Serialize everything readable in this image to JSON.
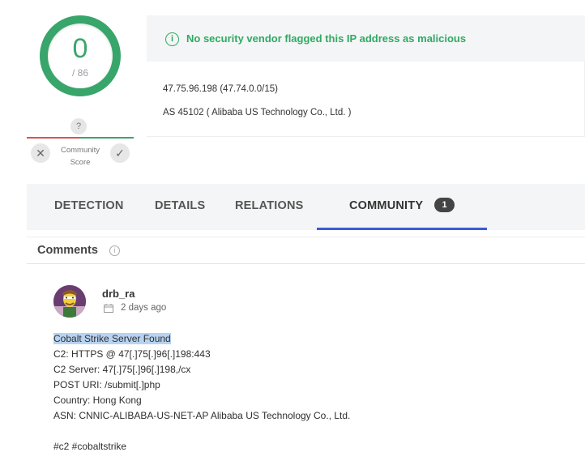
{
  "score": {
    "detections": "0",
    "total": "/ 86"
  },
  "community_score": {
    "label_line1": "Community",
    "label_line2": "Score",
    "question": "?",
    "downvote": "✕",
    "upvote": "✓"
  },
  "status": {
    "message": "No security vendor flagged this IP address as malicious",
    "color": "#2faa63"
  },
  "ip_info": {
    "ip_range": "47.75.96.198  (47.74.0.0/15)",
    "as": "AS 45102 ( Alibaba US Technology Co., Ltd. )"
  },
  "tabs": [
    {
      "label": "DETECTION"
    },
    {
      "label": "DETAILS"
    },
    {
      "label": "RELATIONS"
    },
    {
      "label": "COMMUNITY",
      "badge": "1",
      "active": true
    }
  ],
  "comments": {
    "title": "Comments",
    "items": [
      {
        "user": "drb_ra",
        "date": "2 days ago",
        "lines": [
          "Cobalt Strike Server Found",
          "C2: HTTPS @ 47[.]75[.]96[.]198:443",
          "C2 Server: 47[.]75[.]96[.]198,/cx",
          "POST URI: /submit[.]php",
          "Country: Hong Kong",
          "ASN: CNNIC-ALIBABA-US-NET-AP Alibaba US Technology Co., Ltd.",
          "",
          "#c2 #cobaltstrike"
        ]
      }
    ]
  },
  "colors": {
    "accent": "#3b5bdb",
    "ring": "#38a56a",
    "negative": "#d9534f"
  }
}
